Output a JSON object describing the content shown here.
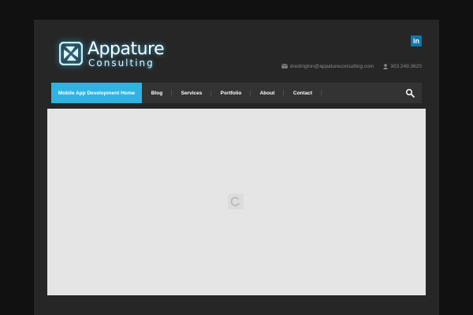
{
  "brand": {
    "title": "Appature",
    "subtitle": "Consulting"
  },
  "social": {
    "linkedin_label": "in"
  },
  "contact": {
    "email": "dredington@appatureconsulting.com",
    "phone": "303.249.3620"
  },
  "nav": {
    "items": [
      {
        "label": "Mobile App Development Home",
        "active": true
      },
      {
        "label": "Blog"
      },
      {
        "label": "Services"
      },
      {
        "label": "Portfolio"
      },
      {
        "label": "About"
      },
      {
        "label": "Contact"
      }
    ]
  },
  "icons": {
    "logo": "aperture-logo-icon",
    "email": "envelope-icon",
    "phone": "person-icon",
    "search": "search-icon",
    "loader": "loading-spinner-icon"
  },
  "colors": {
    "accent": "#2fb4e2",
    "linkedin": "#0e76a8",
    "page_bg": "#111111",
    "container_bg": "#262626",
    "nav_bg": "#333333",
    "hero_bg": "#e5e5e5"
  }
}
